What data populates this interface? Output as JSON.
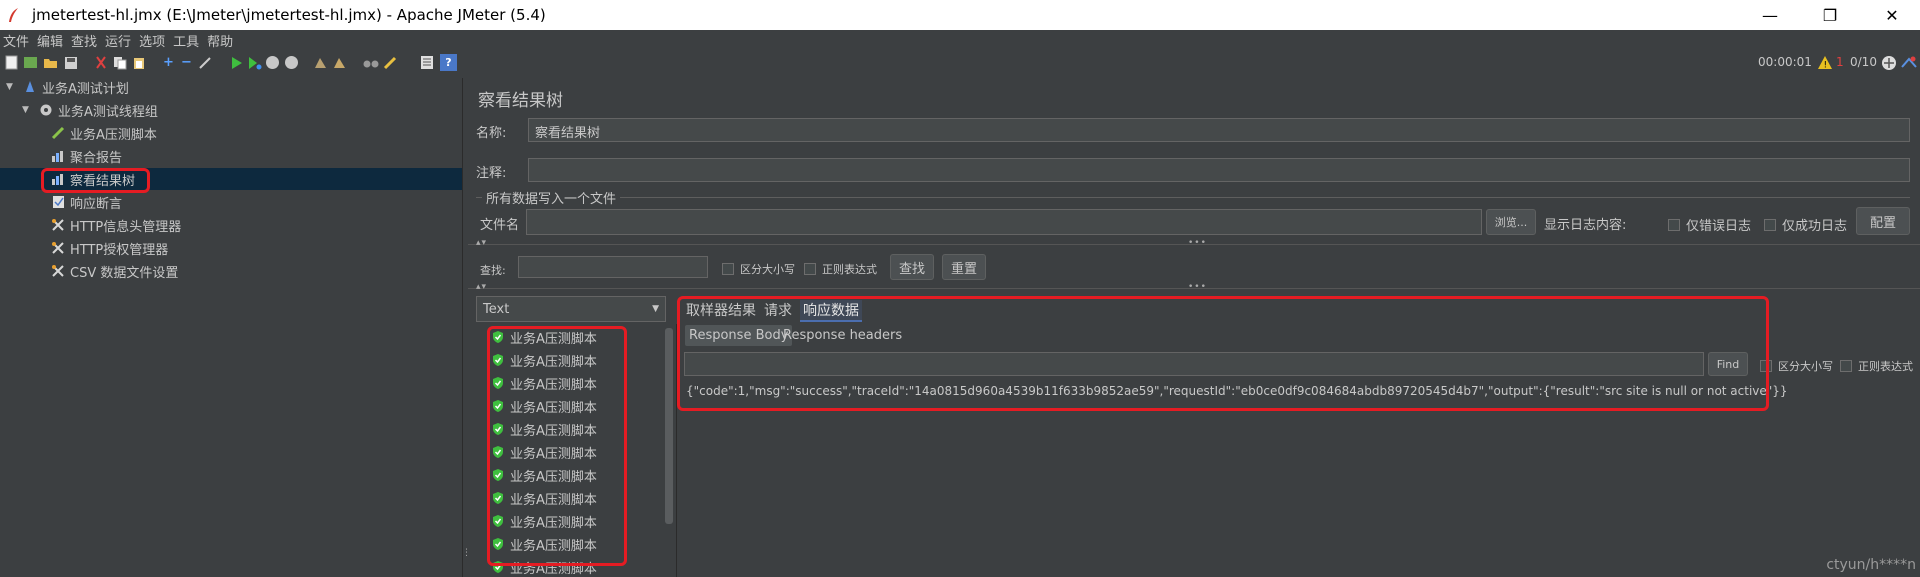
{
  "window": {
    "title": "jmetertest-hl.jmx (E:\\Jmeter\\jmetertest-hl.jmx) - Apache JMeter (5.4)",
    "minimize": "—",
    "maximize": "❐",
    "close": "✕"
  },
  "menu": [
    "文件",
    "编辑",
    "查找",
    "运行",
    "选项",
    "工具",
    "帮助"
  ],
  "status": {
    "timer": "00:00:01",
    "errors": "1",
    "threads": "0/10"
  },
  "tree": {
    "plan": "业务A测试计划",
    "thread_group": "业务A测试线程组",
    "children": [
      "业务A压测脚本",
      "聚合报告",
      "察看结果树",
      "响应断言",
      "HTTP信息头管理器",
      "HTTP授权管理器",
      "CSV 数据文件设置"
    ]
  },
  "panel": {
    "title": "察看结果树",
    "name_label": "名称:",
    "name_value": "察看结果树",
    "comment_label": "注释:",
    "comment_value": "",
    "file_section": "所有数据写入一个文件",
    "file_label": "文件名",
    "file_value": "",
    "browse_btn": "浏览...",
    "log_label": "显示日志内容:",
    "only_errors": "仅错误日志",
    "only_success": "仅成功日志",
    "config_btn": "配置",
    "search_label": "查找:",
    "search_value": "",
    "case_sensitive": "区分大小写",
    "regex": "正则表达式",
    "find_btn": "查找",
    "reset_btn": "重置"
  },
  "results": {
    "renderer": "Text",
    "items": [
      "业务A压测脚本",
      "业务A压测脚本",
      "业务A压测脚本",
      "业务A压测脚本",
      "业务A压测脚本",
      "业务A压测脚本",
      "业务A压测脚本",
      "业务A压测脚本",
      "业务A压测脚本",
      "业务A压测脚本",
      "业务A压测脚本"
    ]
  },
  "response": {
    "tabs": [
      "取样器结果",
      "请求",
      "响应数据"
    ],
    "subtabs": [
      "Response Body",
      "Response headers"
    ],
    "find_btn": "Find",
    "case_sensitive": "区分大小写",
    "regex": "正则表达式",
    "body": "{\"code\":1,\"msg\":\"success\",\"traceId\":\"14a0815d960a4539b11f633b9852ae59\",\"requestId\":\"eb0ce0df9c084684abdb89720545d4b7\",\"output\":{\"result\":\"src site is null or not active\"}}"
  },
  "watermark": "ctyun/h****n",
  "colors": {
    "background": "#3c3f41",
    "selection": "#0d293e",
    "highlight_box": "#e51c23",
    "success": "#3fbf3f"
  }
}
